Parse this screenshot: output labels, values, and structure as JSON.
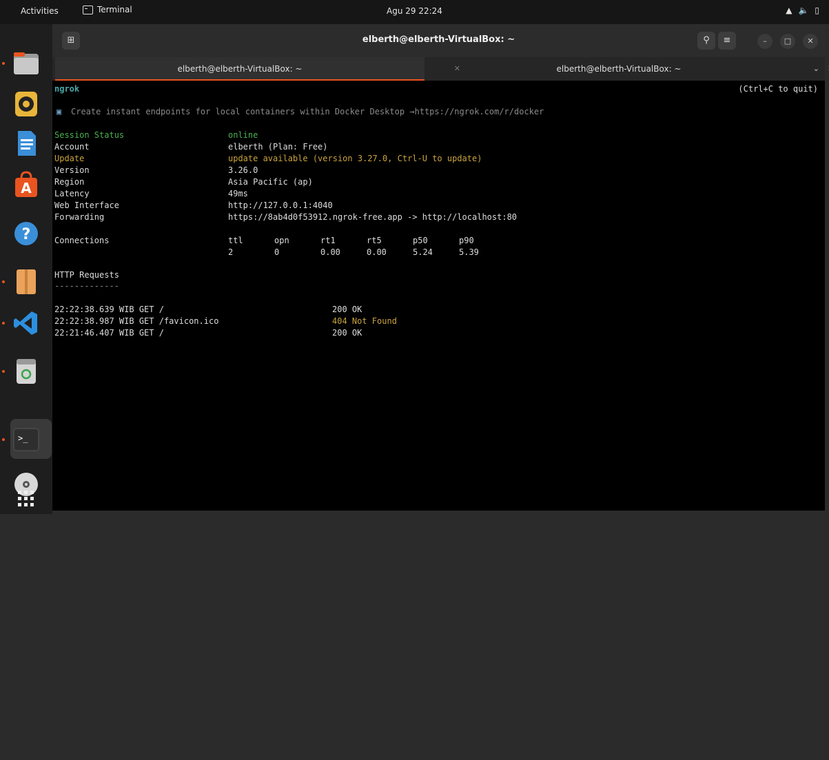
{
  "topbar": {
    "activities": "Activities",
    "app_name": "Terminal",
    "clock": "Agu 29  22:24"
  },
  "window": {
    "title": "elberth@elberth-VirtualBox: ~",
    "tabs": [
      {
        "label": "elberth@elberth-VirtualBox: ~",
        "active": true
      },
      {
        "label": "elberth@elberth-VirtualBox: ~",
        "active": false
      }
    ]
  },
  "terminal": {
    "app_name": "ngrok",
    "quit_hint": "(Ctrl+C to quit)",
    "banner": "Create instant endpoints for local containers within Docker Desktop →https://ngrok.com/r/docker",
    "fields": [
      {
        "key": "Session Status",
        "value": "online"
      },
      {
        "key": "Account",
        "value": "elberth (Plan: Free)"
      },
      {
        "key": "Update",
        "value": "update available (version 3.27.0, Ctrl-U to update)"
      },
      {
        "key": "Version",
        "value": "3.26.0"
      },
      {
        "key": "Region",
        "value": "Asia Pacific (ap)"
      },
      {
        "key": "Latency",
        "value": "49ms"
      },
      {
        "key": "Web Interface",
        "value": "http://127.0.0.1:4040"
      },
      {
        "key": "Forwarding",
        "value": "https://8ab4d0f53912.ngrok-free.app -> http://localhost:80"
      }
    ],
    "connections": {
      "label": "Connections",
      "headers": [
        "ttl",
        "opn",
        "rt1",
        "rt5",
        "p50",
        "p90"
      ],
      "values": [
        "2",
        "0",
        "0.00",
        "0.00",
        "5.24",
        "5.39"
      ]
    },
    "http_requests": {
      "label": "HTTP Requests",
      "separator": "-------------",
      "rows": [
        {
          "request": "22:22:38.639 WIB GET /",
          "status": "200 OK"
        },
        {
          "request": "22:22:38.987 WIB GET /favicon.ico",
          "status": "404 Not Found"
        },
        {
          "request": "22:21:46.407 WIB GET /",
          "status": "200 OK"
        }
      ]
    }
  },
  "colors": {
    "accent": "#e95420",
    "online": "#49b04f",
    "warning": "#c9a33d",
    "title": "#4aa8a8"
  }
}
